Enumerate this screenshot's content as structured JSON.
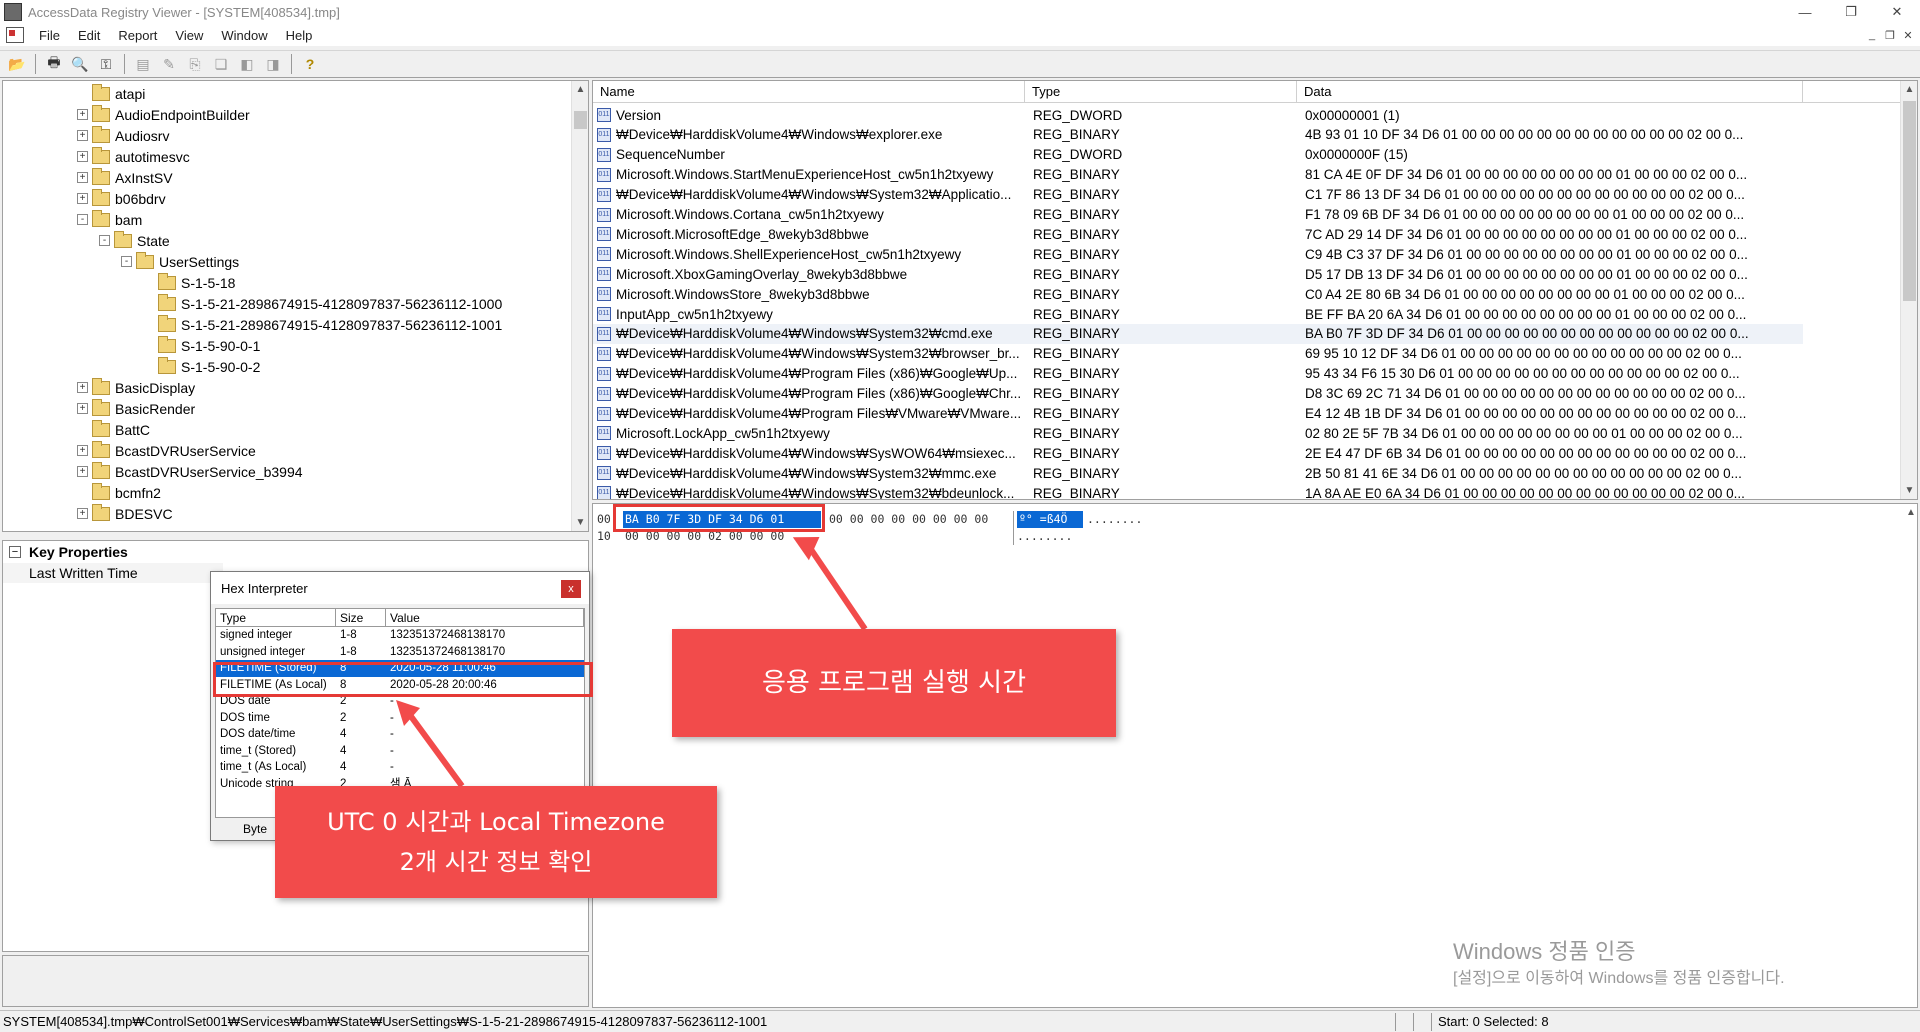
{
  "window": {
    "title": "AccessData Registry Viewer - [SYSTEM[408534].tmp]",
    "buttons": [
      "—",
      "❐",
      "✕"
    ]
  },
  "menu": [
    "File",
    "Edit",
    "Report",
    "View",
    "Window",
    "Help"
  ],
  "toolbar": {
    "icons": [
      "open-icon",
      "print-icon",
      "find-icon",
      "key-icon",
      "report-icon",
      "edit-icon",
      "export-icon",
      "copy-icon",
      "nav-back-icon",
      "nav-forward-icon",
      "help-icon"
    ]
  },
  "tree": [
    {
      "label": "atapi",
      "level": 0,
      "exp": "none"
    },
    {
      "label": "AudioEndpointBuilder",
      "level": 0,
      "exp": "+"
    },
    {
      "label": "Audiosrv",
      "level": 0,
      "exp": "+"
    },
    {
      "label": "autotimesvc",
      "level": 0,
      "exp": "+"
    },
    {
      "label": "AxInstSV",
      "level": 0,
      "exp": "+"
    },
    {
      "label": "b06bdrv",
      "level": 0,
      "exp": "+"
    },
    {
      "label": "bam",
      "level": 0,
      "exp": "-"
    },
    {
      "label": "State",
      "level": 1,
      "exp": "-"
    },
    {
      "label": "UserSettings",
      "level": 2,
      "exp": "-"
    },
    {
      "label": "S-1-5-18",
      "level": 3,
      "exp": "none"
    },
    {
      "label": "S-1-5-21-2898674915-4128097837-56236112-1000",
      "level": 3,
      "exp": "none"
    },
    {
      "label": "S-1-5-21-2898674915-4128097837-56236112-1001",
      "level": 3,
      "exp": "none"
    },
    {
      "label": "S-1-5-90-0-1",
      "level": 3,
      "exp": "none"
    },
    {
      "label": "S-1-5-90-0-2",
      "level": 3,
      "exp": "none"
    },
    {
      "label": "BasicDisplay",
      "level": 0,
      "exp": "+"
    },
    {
      "label": "BasicRender",
      "level": 0,
      "exp": "+"
    },
    {
      "label": "BattC",
      "level": 0,
      "exp": "none"
    },
    {
      "label": "BcastDVRUserService",
      "level": 0,
      "exp": "+"
    },
    {
      "label": "BcastDVRUserService_b3994",
      "level": 0,
      "exp": "+"
    },
    {
      "label": "bcmfn2",
      "level": 0,
      "exp": "none"
    },
    {
      "label": "BDESVC",
      "level": 0,
      "exp": "+"
    }
  ],
  "props": {
    "header": "Key Properties",
    "rows": [
      "Last Written Time"
    ]
  },
  "hex_interpreter": {
    "title": "Hex Interpreter",
    "close": "x",
    "columns": [
      "Type",
      "Size",
      "Value"
    ],
    "rows": [
      {
        "type": "signed integer",
        "size": "1-8",
        "value": "132351372468138170"
      },
      {
        "type": "unsigned integer",
        "size": "1-8",
        "value": "132351372468138170"
      },
      {
        "type": "FILETIME (Stored)",
        "size": "8",
        "value": "2020-05-28 11:00:46"
      },
      {
        "type": "FILETIME (As Local)",
        "size": "8",
        "value": "2020-05-28 20:00:46"
      },
      {
        "type": "DOS date",
        "size": "2",
        "value": "-"
      },
      {
        "type": "DOS time",
        "size": "2",
        "value": "-"
      },
      {
        "type": "DOS date/time",
        "size": "4",
        "value": "-"
      },
      {
        "type": "time_t (Stored)",
        "size": "4",
        "value": "-"
      },
      {
        "type": "time_t (As Local)",
        "size": "4",
        "value": "-"
      },
      {
        "type": "Unicode string",
        "size": "2",
        "value": "샘 Ā"
      }
    ],
    "byte_label": "Byte"
  },
  "list": {
    "columns": [
      "Name",
      "Type",
      "Data"
    ],
    "rows": [
      {
        "name": "Version",
        "type": "REG_DWORD",
        "data": "0x00000001 (1)"
      },
      {
        "name": "₩Device₩HarddiskVolume4₩Windows₩explorer.exe",
        "type": "REG_BINARY",
        "data": "4B 93 01 10 DF 34 D6 01 00 00 00 00 00 00 00 00 00 00 00 00 02 00 0..."
      },
      {
        "name": "SequenceNumber",
        "type": "REG_DWORD",
        "data": "0x0000000F (15)"
      },
      {
        "name": "Microsoft.Windows.StartMenuExperienceHost_cw5n1h2txyewy",
        "type": "REG_BINARY",
        "data": "81 CA 4E 0F DF 34 D6 01 00 00 00 00 00 00 00 00 01 00 00 00 02 00 0..."
      },
      {
        "name": "₩Device₩HarddiskVolume4₩Windows₩System32₩Applicatio...",
        "type": "REG_BINARY",
        "data": "C1 7F 86 13 DF 34 D6 01 00 00 00 00 00 00 00 00 00 00 00 00 02 00 0..."
      },
      {
        "name": "Microsoft.Windows.Cortana_cw5n1h2txyewy",
        "type": "REG_BINARY",
        "data": "F1 78 09 6B DF 34 D6 01 00 00 00 00 00 00 00 00 01 00 00 00 02 00 0..."
      },
      {
        "name": "Microsoft.MicrosoftEdge_8wekyb3d8bbwe",
        "type": "REG_BINARY",
        "data": "7C AD 29 14 DF 34 D6 01 00 00 00 00 00 00 00 00 01 00 00 00 02 00 0..."
      },
      {
        "name": "Microsoft.Windows.ShellExperienceHost_cw5n1h2txyewy",
        "type": "REG_BINARY",
        "data": "C9 4B C3 37 DF 34 D6 01 00 00 00 00 00 00 00 00 01 00 00 00 02 00 0..."
      },
      {
        "name": "Microsoft.XboxGamingOverlay_8wekyb3d8bbwe",
        "type": "REG_BINARY",
        "data": "D5 17 DB 13 DF 34 D6 01 00 00 00 00 00 00 00 00 01 00 00 00 02 00 0..."
      },
      {
        "name": "Microsoft.WindowsStore_8wekyb3d8bbwe",
        "type": "REG_BINARY",
        "data": "C0 A4 2E 80 6B 34 D6 01 00 00 00 00 00 00 00 00 01 00 00 00 02 00 0..."
      },
      {
        "name": "InputApp_cw5n1h2txyewy",
        "type": "REG_BINARY",
        "data": "BE FF BA 20 6A 34 D6 01 00 00 00 00 00 00 00 00 01 00 00 00 02 00 0..."
      },
      {
        "name": "₩Device₩HarddiskVolume4₩Windows₩System32₩cmd.exe",
        "type": "REG_BINARY",
        "data": "BA B0 7F 3D DF 34 D6 01 00 00 00 00 00 00 00 00 00 00 00 00 02 00 0..."
      },
      {
        "name": "₩Device₩HarddiskVolume4₩Windows₩System32₩browser_br...",
        "type": "REG_BINARY",
        "data": "69 95 10 12 DF 34 D6 01 00 00 00 00 00 00 00 00 00 00 00 00 02 00 0..."
      },
      {
        "name": "₩Device₩HarddiskVolume4₩Program Files (x86)₩Google₩Up...",
        "type": "REG_BINARY",
        "data": "95 43 34 F6 15 30 D6 01 00 00 00 00 00 00 00 00 00 00 00 00 02 00 0..."
      },
      {
        "name": "₩Device₩HarddiskVolume4₩Program Files (x86)₩Google₩Chr...",
        "type": "REG_BINARY",
        "data": "D8 3C 69 2C 71 34 D6 01 00 00 00 00 00 00 00 00 00 00 00 00 02 00 0..."
      },
      {
        "name": "₩Device₩HarddiskVolume4₩Program Files₩VMware₩VMware...",
        "type": "REG_BINARY",
        "data": "E4 12 4B 1B DF 34 D6 01 00 00 00 00 00 00 00 00 00 00 00 00 02 00 0..."
      },
      {
        "name": "Microsoft.LockApp_cw5n1h2txyewy",
        "type": "REG_BINARY",
        "data": "02 80 2E 5F 7B 34 D6 01 00 00 00 00 00 00 00 00 01 00 00 00 02 00 0..."
      },
      {
        "name": "₩Device₩HarddiskVolume4₩Windows₩SysWOW64₩msiexec...",
        "type": "REG_BINARY",
        "data": "2E E4 47 DF 6B 34 D6 01 00 00 00 00 00 00 00 00 00 00 00 00 02 00 0..."
      },
      {
        "name": "₩Device₩HarddiskVolume4₩Windows₩System32₩mmc.exe",
        "type": "REG_BINARY",
        "data": "2B 50 81 41 6E 34 D6 01 00 00 00 00 00 00 00 00 00 00 00 00 02 00 0..."
      },
      {
        "name": "₩Device₩HarddiskVolume4₩Windows₩System32₩bdeunlock...",
        "type": "REG_BINARY",
        "data": "1A 8A AE E0 6A 34 D6 01 00 00 00 00 00 00 00 00 00 00 00 00 02 00 0..."
      }
    ]
  },
  "hex": {
    "line0_offset": "00",
    "line0_selected": "BA B0 7F 3D DF 34 D6 01",
    "line0_rest": "00 00 00 00 00 00 00 00",
    "line0_ascii_selected": "º° =ß4Ö",
    "line0_ascii_rest": "........",
    "line1_offset": "10",
    "line1_hex": "00 00 00 00 02 00 00 00",
    "line1_ascii": "........"
  },
  "watermark": {
    "line1": "Windows 정품 인증",
    "line2": "[설정]으로 이동하여 Windows를 정품 인증합니다."
  },
  "status": {
    "path": "SYSTEM[408534].tmp₩ControlSet001₩Services₩bam₩State₩UserSettings₩S-1-5-21-2898674915-4128097837-56236112-1001",
    "count": "Start: 0 Selected: 8"
  },
  "annotations": {
    "callout_right": "응용 프로그램 실행 시간",
    "callout_left_line1": "UTC 0 시간과 Local Timezone",
    "callout_left_line2": "2개 시간 정보 확인",
    "color": "#f24b4b"
  }
}
